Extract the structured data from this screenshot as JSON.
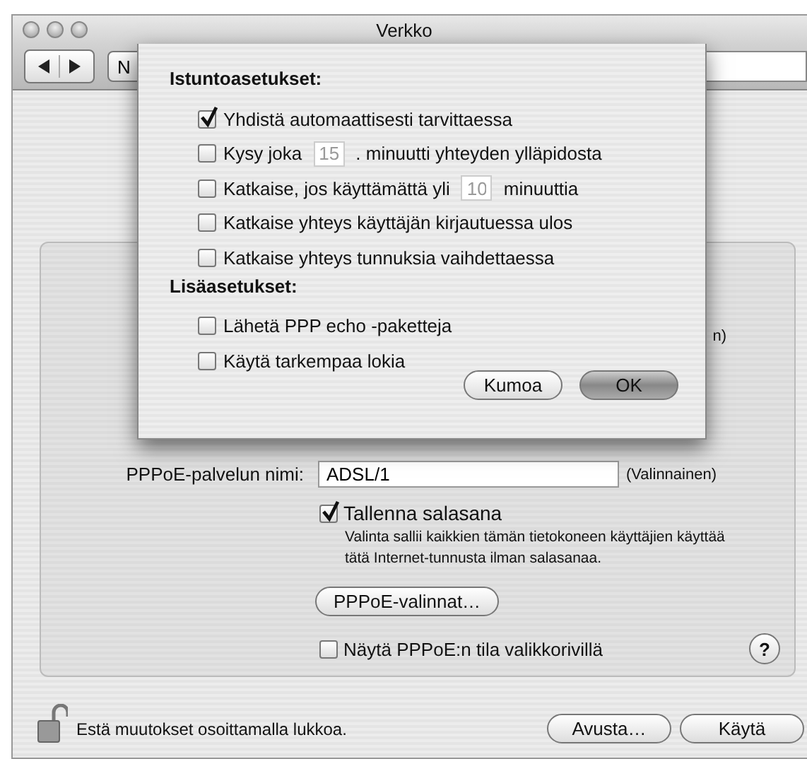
{
  "window": {
    "title": "Verkko"
  },
  "toolbar": {
    "show_all_button": "N"
  },
  "panel": {
    "partial_label": "n)",
    "service_name": {
      "label": "PPPoE-palvelun nimi:",
      "value": "ADSL/1",
      "hint": "(Valinnainen)"
    },
    "save_password": {
      "label": "Tallenna salasana",
      "checked": true,
      "description": "Valinta sallii kaikkien tämän tietokoneen käyttäjien käyttää tätä Internet-tunnusta ilman salasanaa."
    },
    "options_button": "PPPoE-valinnat…",
    "menu_status": {
      "label": "Näytä PPPoE:n tila valikkorivillä",
      "checked": false
    },
    "help_button": "?"
  },
  "footer": {
    "lock_text": "Estä muutokset osoittamalla lukkoa.",
    "buttons": [
      "Avusta…",
      "Käytä"
    ]
  },
  "sheet": {
    "sections": [
      {
        "heading": "Istuntoasetukset:",
        "options": [
          {
            "kind": "checkbox",
            "label": "Yhdistä automaattisesti tarvittaessa",
            "checked": true
          },
          {
            "kind": "field",
            "label": "Kysy joka",
            "value": "15",
            "after": ". minuutti yhteyden ylläpidosta",
            "checked": false
          },
          {
            "kind": "field",
            "label": "Katkaise, jos käyttämättä yli",
            "value": "10",
            "after": "minuuttia",
            "checked": false
          },
          {
            "kind": "checkbox",
            "label": "Katkaise yhteys käyttäjän kirjautuessa ulos",
            "checked": false
          },
          {
            "kind": "checkbox",
            "label": "Katkaise yhteys tunnuksia vaihdettaessa",
            "checked": false
          }
        ]
      },
      {
        "heading": "Lisäasetukset:",
        "options": [
          {
            "kind": "checkbox",
            "label": "Lähetä PPP echo -paketteja",
            "checked": false
          },
          {
            "kind": "checkbox",
            "label": "Käytä tarkempaa lokia",
            "checked": false
          }
        ]
      }
    ],
    "buttons": [
      {
        "label": "Kumoa",
        "default": false
      },
      {
        "label": "OK",
        "default": true
      }
    ]
  }
}
